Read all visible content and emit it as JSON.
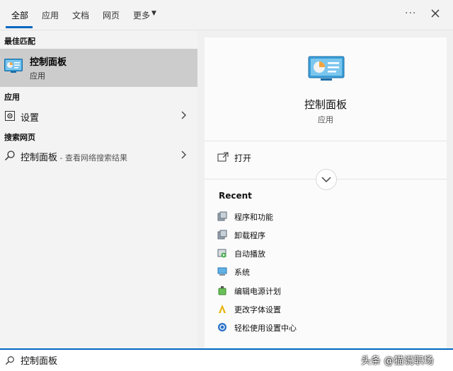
{
  "tabs": [
    {
      "label": "全部",
      "active": true
    },
    {
      "label": "应用"
    },
    {
      "label": "文档"
    },
    {
      "label": "网页"
    },
    {
      "label": "更多"
    }
  ],
  "left": {
    "best_match_heading": "最佳匹配",
    "best_match": {
      "title": "控制面板",
      "subtitle": "应用",
      "icon": "control-panel-icon"
    },
    "apps_heading": "应用",
    "apps": [
      {
        "label": "设置",
        "icon": "gear-icon"
      }
    ],
    "web_heading": "搜索网页",
    "web": [
      {
        "label": "控制面板",
        "hint": " - 查看网络搜索结果",
        "icon": "search-icon"
      }
    ]
  },
  "right": {
    "title": "控制面板",
    "subtitle": "应用",
    "open_label": "打开",
    "recent_title": "Recent",
    "recent": [
      {
        "label": "程序和功能",
        "icon": "programs-icon"
      },
      {
        "label": "卸载程序",
        "icon": "uninstall-icon"
      },
      {
        "label": "自动播放",
        "icon": "autoplay-icon"
      },
      {
        "label": "系统",
        "icon": "system-icon"
      },
      {
        "label": "编辑电源计划",
        "icon": "power-plan-icon"
      },
      {
        "label": "更改字体设置",
        "icon": "font-icon"
      },
      {
        "label": "轻松使用设置中心",
        "icon": "ease-of-access-icon"
      }
    ]
  },
  "search": {
    "value": "控制面板"
  },
  "watermark": "头条 @猫说职场",
  "colors": {
    "accent": "#0067c0",
    "selected": "#cccccc"
  }
}
